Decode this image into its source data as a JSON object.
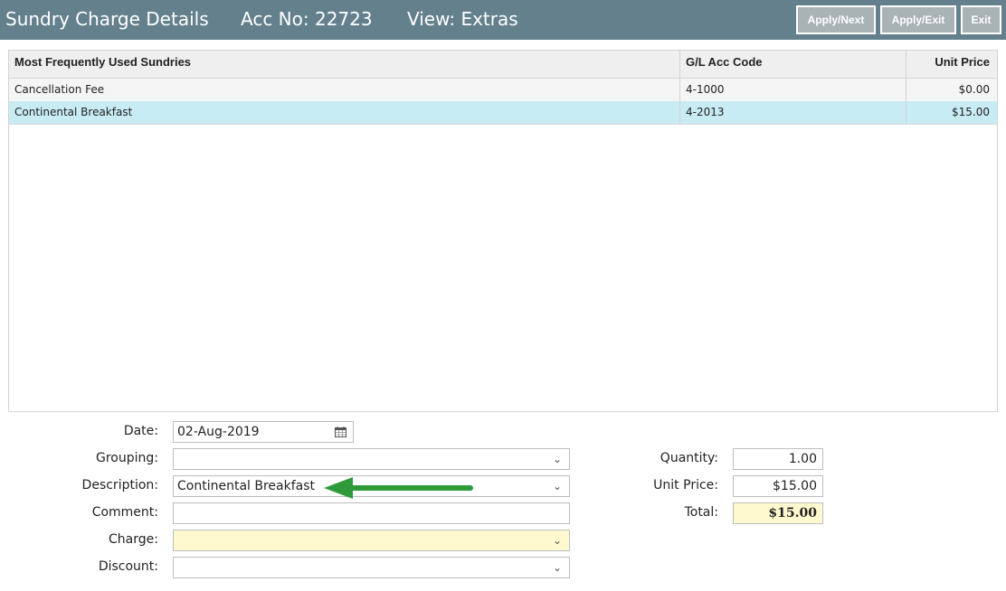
{
  "header": {
    "title": "Sundry Charge Details",
    "acc": "Acc No: 22723",
    "view": "View: Extras",
    "buttons": {
      "apply_next": "Apply/Next",
      "apply_exit": "Apply/Exit",
      "exit": "Exit"
    }
  },
  "grid": {
    "columns": [
      "Most Frequently Used Sundries",
      "G/L Acc Code",
      "Unit Price"
    ],
    "rows": [
      {
        "name": "Cancellation Fee",
        "code": "4-1000",
        "price": "$0.00"
      },
      {
        "name": "Continental Breakfast",
        "code": "4-2013",
        "price": "$15.00"
      }
    ]
  },
  "form": {
    "date_label": "Date:",
    "date_value": "02-Aug-2019",
    "grouping_label": "Grouping:",
    "grouping_value": "",
    "description_label": "Description:",
    "description_value": "Continental Breakfast",
    "comment_label": "Comment:",
    "comment_value": "",
    "charge_label": "Charge:",
    "charge_value": "",
    "discount_label": "Discount:",
    "discount_value": "",
    "quantity_label": "Quantity:",
    "quantity_value": "1.00",
    "unit_price_label": "Unit Price:",
    "unit_price_value": "$15.00",
    "total_label": "Total:",
    "total_value": "$15.00"
  },
  "colors": {
    "header_bg": "#63808c",
    "selected_row": "#c8ecf4",
    "highlight_field": "#fff9cf",
    "arrow": "#2e9a3a"
  }
}
